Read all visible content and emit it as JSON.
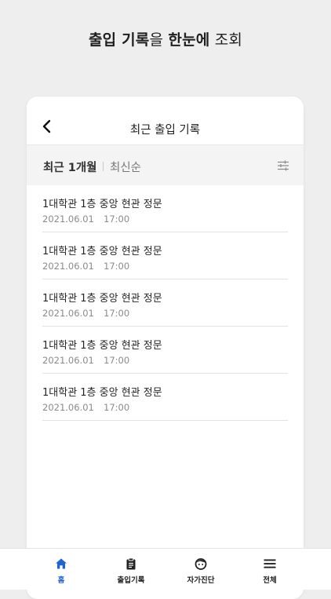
{
  "headline": {
    "part1": "출입 기록",
    "part2": "을 ",
    "part3": "한눈에",
    "part4": " 조회"
  },
  "header": {
    "title": "최근 출입 기록",
    "back_icon": "chevron-left-icon"
  },
  "filter": {
    "period": "최근 1개월",
    "sort": "최신순",
    "icon": "filter-sliders-icon"
  },
  "records": [
    {
      "location": "1대학관 1층 중앙 현관 정문",
      "date": "2021.06.01",
      "time": "17:00"
    },
    {
      "location": "1대학관 1층 중앙 현관 정문",
      "date": "2021.06.01",
      "time": "17:00"
    },
    {
      "location": "1대학관 1층 중앙 현관 정문",
      "date": "2021.06.01",
      "time": "17:00"
    },
    {
      "location": "1대학관 1층 중앙 현관 정문",
      "date": "2021.06.01",
      "time": "17:00"
    },
    {
      "location": "1대학관 1층 중앙 현관 정문",
      "date": "2021.06.01",
      "time": "17:00"
    }
  ],
  "nav": {
    "active_color": "#1f63d6",
    "items": [
      {
        "label": "홈",
        "icon": "home-icon",
        "active": true
      },
      {
        "label": "출입기록",
        "icon": "clipboard-icon",
        "active": false
      },
      {
        "label": "자가진단",
        "icon": "face-icon",
        "active": false
      },
      {
        "label": "전체",
        "icon": "menu-icon",
        "active": false
      }
    ]
  }
}
